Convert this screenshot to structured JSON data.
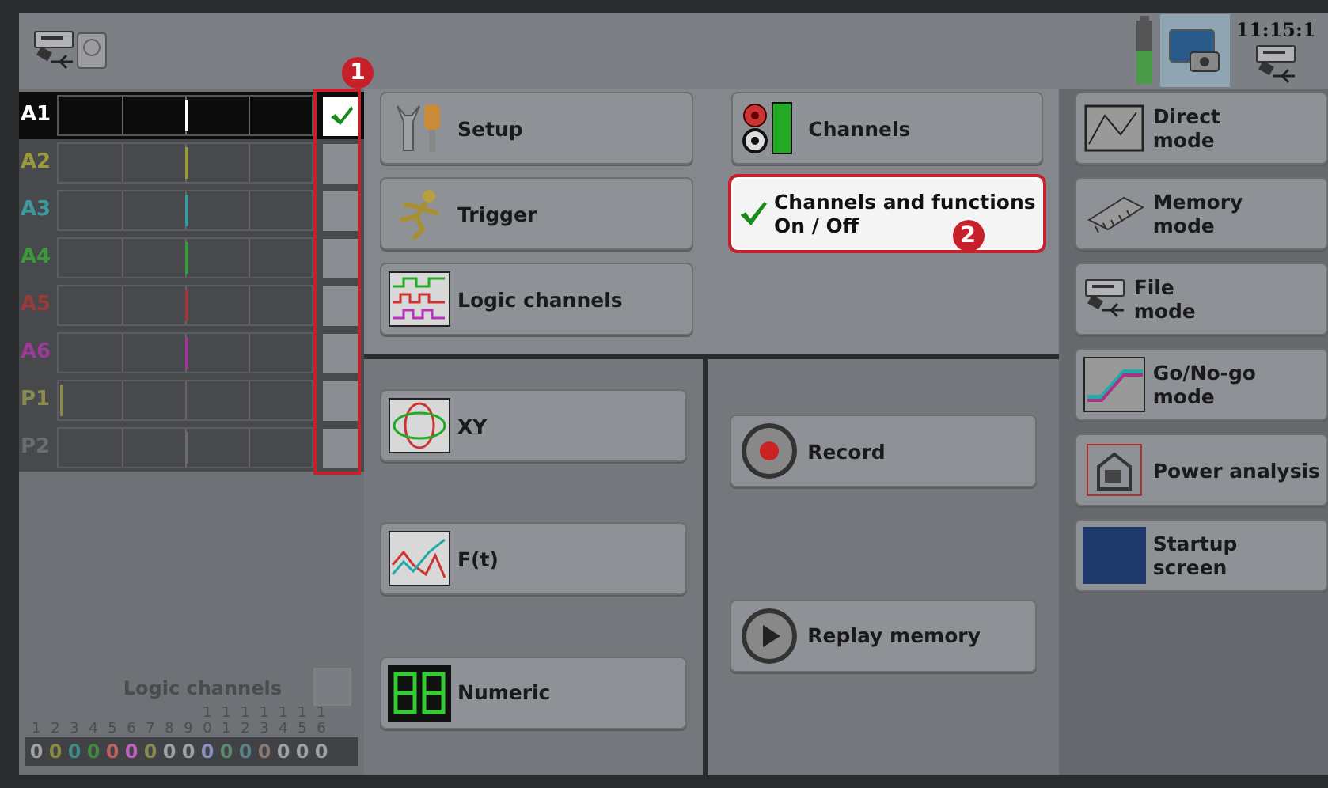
{
  "header": {
    "time": "11:15:1"
  },
  "channels": [
    {
      "label": "A1",
      "color": "#ffffff",
      "checked": true,
      "highlighted": true
    },
    {
      "label": "A2",
      "color": "#9a9a3a",
      "checked": false,
      "highlighted": false
    },
    {
      "label": "A3",
      "color": "#3a9aa0",
      "checked": false,
      "highlighted": false
    },
    {
      "label": "A4",
      "color": "#3a9a3a",
      "checked": false,
      "highlighted": false
    },
    {
      "label": "A5",
      "color": "#9a3a3a",
      "checked": false,
      "highlighted": false
    },
    {
      "label": "A6",
      "color": "#9a3a9a",
      "checked": false,
      "highlighted": false
    },
    {
      "label": "P1",
      "color": "#8a8a50",
      "checked": false,
      "highlighted": false
    },
    {
      "label": "P2",
      "color": "#6a6c70",
      "checked": false,
      "highlighted": false
    }
  ],
  "channels_callout": "1",
  "logic": {
    "title": "Logic channels",
    "checked": false,
    "channels": [
      {
        "number": "1",
        "value": "0",
        "color": "#a0a2a6"
      },
      {
        "number": "2",
        "value": "0",
        "color": "#8a8a40"
      },
      {
        "number": "3",
        "value": "0",
        "color": "#3f8a8a"
      },
      {
        "number": "4",
        "value": "0",
        "color": "#3f8a3f"
      },
      {
        "number": "5",
        "value": "0",
        "color": "#c06060"
      },
      {
        "number": "6",
        "value": "0",
        "color": "#c060c0"
      },
      {
        "number": "7",
        "value": "0",
        "color": "#8a8a50"
      },
      {
        "number": "8",
        "value": "0",
        "color": "#a0a2a6"
      },
      {
        "number": "9",
        "value": "0",
        "color": "#a0a2a6"
      },
      {
        "number": "10",
        "value": "0",
        "color": "#8a90c0"
      },
      {
        "number": "11",
        "value": "0",
        "color": "#5a8a6a"
      },
      {
        "number": "12",
        "value": "0",
        "color": "#5a8088"
      },
      {
        "number": "13",
        "value": "0",
        "color": "#8a7a70"
      },
      {
        "number": "14",
        "value": "0",
        "color": "#a0a2a6"
      },
      {
        "number": "15",
        "value": "0",
        "color": "#a0a2a6"
      },
      {
        "number": "16",
        "value": "0",
        "color": "#a0a2a6"
      }
    ]
  },
  "top_left_buttons": [
    {
      "label": "Setup"
    },
    {
      "label": "Trigger"
    },
    {
      "label": "Logic channels"
    }
  ],
  "top_right_buttons": [
    {
      "label": "Channels",
      "highlighted": false
    },
    {
      "label": "Channels and functions\nOn / Off",
      "highlighted": true,
      "callout": "2"
    }
  ],
  "bottom_left_buttons": [
    {
      "label": "XY"
    },
    {
      "label": "F(t)"
    },
    {
      "label": "Numeric"
    }
  ],
  "bottom_right_buttons": [
    {
      "label": "Record"
    },
    {
      "label": "Replay memory"
    }
  ],
  "mode_buttons": [
    {
      "label": "Direct\nmode"
    },
    {
      "label": "Memory\nmode"
    },
    {
      "label": "File\nmode"
    },
    {
      "label": "Go/No-go\nmode"
    },
    {
      "label": "Power analysis"
    },
    {
      "label": "Startup\nscreen"
    }
  ]
}
